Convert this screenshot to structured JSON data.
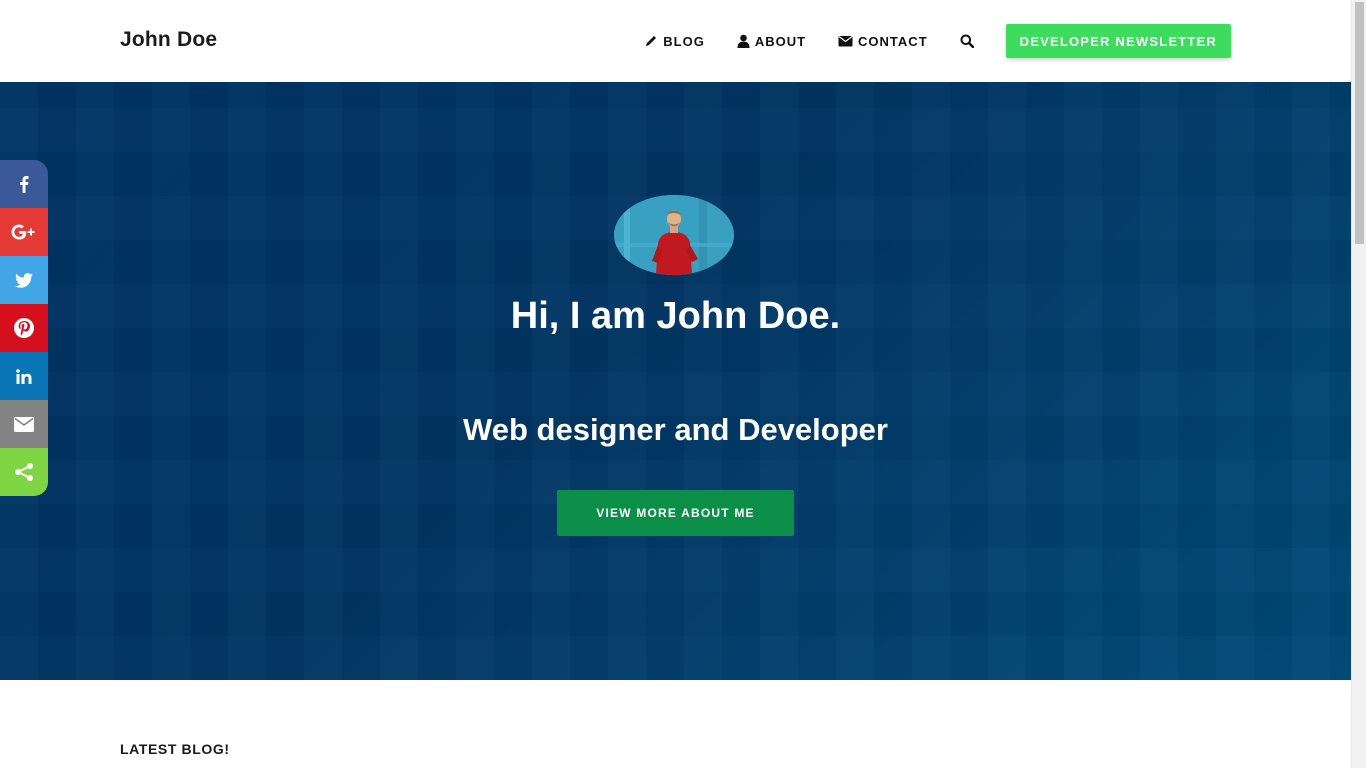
{
  "header": {
    "brand": "John Doe",
    "nav": [
      {
        "label": "BLOG",
        "icon": "pencil-icon"
      },
      {
        "label": "ABOUT",
        "icon": "user-icon"
      },
      {
        "label": "CONTACT",
        "icon": "envelope-icon"
      }
    ],
    "search_icon": "search-icon",
    "newsletter_label": "DEVELOPER NEWSLETTER"
  },
  "hero": {
    "title": "Hi, I am John Doe.",
    "subtitle": "Web designer and Developer",
    "cta_label": "VIEW MORE ABOUT ME",
    "background_color": "#023664"
  },
  "share": [
    {
      "network": "facebook",
      "icon": "facebook-icon",
      "color": "#3b5998"
    },
    {
      "network": "google-plus",
      "icon": "google-plus-icon",
      "color": "#e53935"
    },
    {
      "network": "twitter",
      "icon": "twitter-icon",
      "color": "#42a5e8"
    },
    {
      "network": "pinterest",
      "icon": "pinterest-icon",
      "color": "#d50f1e"
    },
    {
      "network": "linkedin",
      "icon": "linkedin-icon",
      "color": "#0a76b5"
    },
    {
      "network": "email",
      "icon": "email-icon",
      "color": "#848484"
    },
    {
      "network": "share",
      "icon": "share-icon",
      "color": "#7ed645"
    }
  ],
  "latest": {
    "title": "LATEST BLOG!"
  },
  "colors": {
    "accent_green": "#3ddc5e",
    "cta_green": "#0b8f48"
  }
}
